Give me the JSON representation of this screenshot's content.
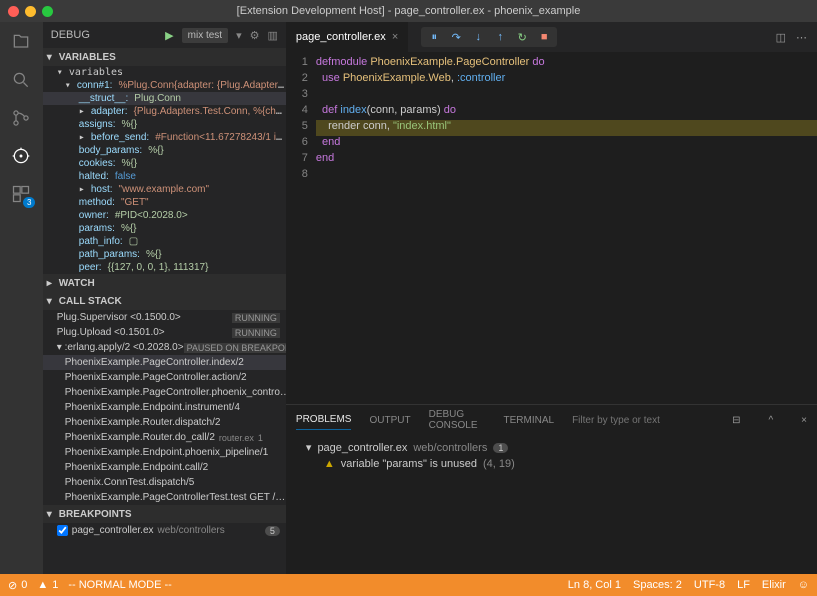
{
  "window": {
    "title": "[Extension Development Host] - page_controller.ex - phoenix_example"
  },
  "debug": {
    "label": "DEBUG",
    "config": "mix test"
  },
  "sections": {
    "variables": "VARIABLES",
    "watch": "WATCH",
    "callstack": "CALL STACK",
    "breakpoints": "BREAKPOINTS"
  },
  "vars_scope": "variables",
  "vars": [
    {
      "depth": 1,
      "exp": true,
      "key": "conn#1:",
      "val": "%Plug.Conn{adapter: {Plug.Adapters.Tes…"
    },
    {
      "depth": 2,
      "sel": true,
      "key": "__struct__:",
      "val": "Plug.Conn",
      "vclass": "vn"
    },
    {
      "depth": 2,
      "exp": false,
      "key": "adapter:",
      "val": "{Plug.Adapters.Test.Conn, %{chunks:…"
    },
    {
      "depth": 2,
      "key": "assigns:",
      "val": "%{}",
      "vclass": "vn"
    },
    {
      "depth": 2,
      "exp": false,
      "key": "before_send:",
      "val": "#Function<11.67278243/1 in :db…"
    },
    {
      "depth": 2,
      "key": "body_params:",
      "val": "%{}",
      "vclass": "vn"
    },
    {
      "depth": 2,
      "key": "cookies:",
      "val": "%{}",
      "vclass": "vn"
    },
    {
      "depth": 2,
      "key": "halted:",
      "val": "false",
      "vclass": "vk"
    },
    {
      "depth": 2,
      "exp": false,
      "key": "host:",
      "val": "\"www.example.com\""
    },
    {
      "depth": 2,
      "key": "method:",
      "val": "\"GET\""
    },
    {
      "depth": 2,
      "key": "owner:",
      "val": "#PID<0.2028.0>",
      "vclass": "vn"
    },
    {
      "depth": 2,
      "key": "params:",
      "val": "%{}",
      "vclass": "vn"
    },
    {
      "depth": 2,
      "key": "path_info:",
      "val": "▢",
      "vclass": "vn"
    },
    {
      "depth": 2,
      "key": "path_params:",
      "val": "%{}",
      "vclass": "vn"
    },
    {
      "depth": 2,
      "key": "peer:",
      "val": "{{127, 0, 0, 1}, 111317}",
      "vclass": "vn"
    }
  ],
  "callstack": [
    {
      "name": "Plug.Supervisor <0.1500.0>",
      "status": "RUNNING"
    },
    {
      "name": "Plug.Upload <0.1501.0>",
      "status": "RUNNING"
    },
    {
      "name": ":erlang.apply/2 <0.2028.0>",
      "status": "PAUSED ON BREAKPOIN…",
      "exp": true
    },
    {
      "name": "PhoenixExample.PageController.index/2",
      "sel": true,
      "indent": true
    },
    {
      "name": "PhoenixExample.PageController.action/2",
      "indent": true
    },
    {
      "name": "PhoenixExample.PageController.phoenix_contro…",
      "indent": true
    },
    {
      "name": "PhoenixExample.Endpoint.instrument/4",
      "indent": true
    },
    {
      "name": "PhoenixExample.Router.dispatch/2",
      "indent": true
    },
    {
      "name": "PhoenixExample.Router.do_call/2",
      "sub": "router.ex",
      "subn": "1",
      "indent": true
    },
    {
      "name": "PhoenixExample.Endpoint.phoenix_pipeline/1",
      "indent": true
    },
    {
      "name": "PhoenixExample.Endpoint.call/2",
      "indent": true
    },
    {
      "name": "Phoenix.ConnTest.dispatch/5",
      "indent": true
    },
    {
      "name": "PhoenixExample.PageControllerTest.test GET /…",
      "indent": true
    }
  ],
  "breakpoints": [
    {
      "checked": true,
      "file": "page_controller.ex",
      "path": "web/controllers",
      "count": "5"
    }
  ],
  "editor": {
    "tab": "page_controller.ex",
    "lines": [
      "1",
      "2",
      "3",
      "4",
      "5",
      "6",
      "7",
      "8"
    ],
    "l1a": "defmodule ",
    "l1b": "PhoenixExample.PageController ",
    "l1c": "do",
    "l2a": "  use ",
    "l2b": "PhoenixExample.Web",
    "l2c": ", ",
    "l2d": ":controller",
    "l4a": "  def ",
    "l4b": "index",
    "l4c": "(conn, params) ",
    "l4d": "do",
    "l5a": "    render conn, ",
    "l5b": "\"index.html\"",
    "l6": "  end",
    "l7": "end"
  },
  "panel": {
    "tabs": {
      "problems": "PROBLEMS",
      "output": "OUTPUT",
      "debug": "DEBUG CONSOLE",
      "terminal": "TERMINAL"
    },
    "filter_ph": "Filter by type or text",
    "file": "page_controller.ex",
    "path": "web/controllers",
    "count": "1",
    "msg": "variable \"params\" is unused",
    "loc": "(4, 19)"
  },
  "status": {
    "errors": "0",
    "warnings": "1",
    "mode": "-- NORMAL MODE --",
    "pos": "Ln 8, Col 1",
    "spaces": "Spaces: 2",
    "enc": "UTF-8",
    "eol": "LF",
    "lang": "Elixir"
  }
}
